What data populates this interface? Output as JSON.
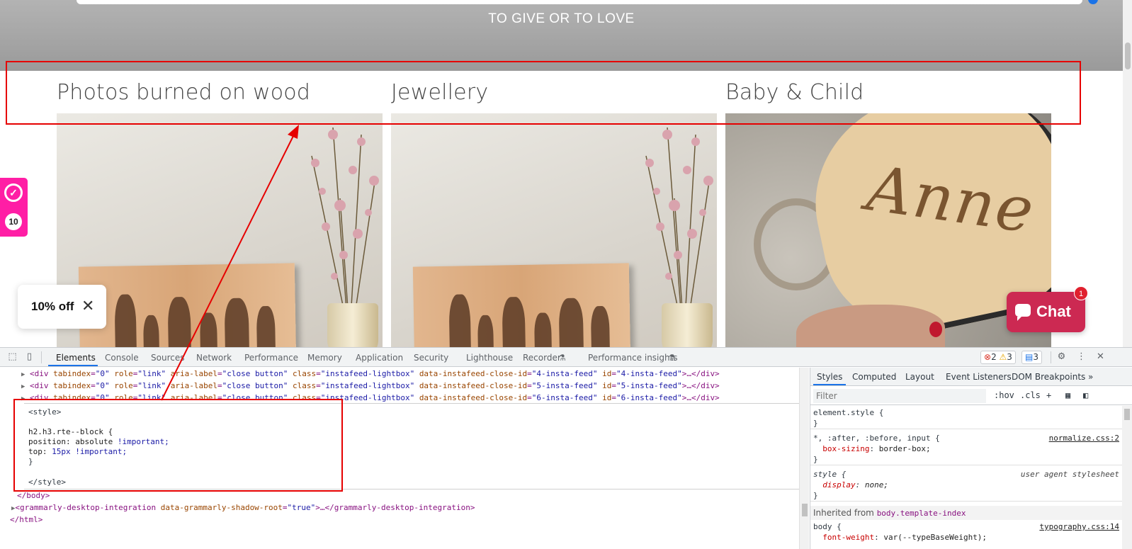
{
  "site": {
    "hero_title": "TO GIVE OR TO LOVE",
    "columns": [
      {
        "title": "Photos burned on wood",
        "image": "wood-photo-family-with-flowers"
      },
      {
        "title": "Jewellery",
        "image": "wood-photo-family-with-flowers"
      },
      {
        "title": "Baby & Child",
        "image": "wooden-heart-engraved-anne"
      }
    ],
    "heart_engraving": "Anne",
    "rewards": {
      "count": "10",
      "icon": "check-circle-icon"
    },
    "discount": {
      "label": "10% off",
      "close": "✕"
    },
    "chat": {
      "label": "Chat",
      "badge": "1"
    }
  },
  "devtools": {
    "tabs": [
      "Elements",
      "Console",
      "Sources",
      "Network",
      "Performance",
      "Memory",
      "Application",
      "Security",
      "Lighthouse",
      "Recorder",
      "Performance insights"
    ],
    "active_tab": "Elements",
    "status": {
      "errors": "2",
      "warnings": "3",
      "messages": "3"
    },
    "dom_lines": [
      {
        "tag": "div",
        "attrs": [
          [
            "tabindex",
            "0"
          ],
          [
            "role",
            "link"
          ],
          [
            "aria-label",
            "close button"
          ],
          [
            "class",
            "instafeed-lightbox"
          ],
          [
            "data-instafeed-close-id",
            "4-insta-feed"
          ],
          [
            "id",
            "4-insta-feed"
          ]
        ],
        "tail": ">…</div>"
      },
      {
        "tag": "div",
        "attrs": [
          [
            "tabindex",
            "0"
          ],
          [
            "role",
            "link"
          ],
          [
            "aria-label",
            "close button"
          ],
          [
            "class",
            "instafeed-lightbox"
          ],
          [
            "data-instafeed-close-id",
            "5-insta-feed"
          ],
          [
            "id",
            "5-insta-feed"
          ]
        ],
        "tail": ">…</div>"
      },
      {
        "tag": "div",
        "attrs": [
          [
            "tabindex",
            "0"
          ],
          [
            "role",
            "link"
          ],
          [
            "aria-label",
            "close button"
          ],
          [
            "class",
            "instafeed-lightbox"
          ],
          [
            "data-instafeed-close-id",
            "6-insta-feed"
          ],
          [
            "id",
            "6-insta-feed"
          ]
        ],
        "tail": ">…</div>"
      }
    ],
    "style_block": {
      "open": "<style>",
      "selector": "h2.h3.rte--block {",
      "decl1_prop": "position:",
      "decl1_val": "absolute",
      "decl1_imp": "!important;",
      "decl2_prop": "top:",
      "decl2_val": "15px",
      "decl2_imp": "!important;",
      "close_brace": "}",
      "close": "</style>"
    },
    "body_close": "</body>",
    "grammarly_line": {
      "tag": "grammarly-desktop-integration",
      "attr": "data-grammarly-shadow-root",
      "val": "true",
      "tail": ">…</grammarly-desktop-integration>"
    },
    "html_close": "</html>",
    "styles_pane": {
      "tabs": [
        "Styles",
        "Computed",
        "Layout",
        "Event Listeners",
        "DOM Breakpoints",
        "»"
      ],
      "filter_placeholder": "Filter",
      "filter_buttons": [
        ":hov",
        ".cls",
        "+"
      ],
      "rules": [
        {
          "selector": "element.style {",
          "source": "",
          "decls": [],
          "close": "}"
        },
        {
          "selector": "*, :after, :before, input {",
          "source": "normalize.css:2",
          "decls": [
            [
              "box-sizing",
              "border-box;"
            ]
          ],
          "close": "}"
        },
        {
          "selector": "style {",
          "source": "user agent stylesheet",
          "decls": [
            [
              "display",
              "none;"
            ]
          ],
          "close": "}"
        }
      ],
      "inherited_label": "Inherited from",
      "inherited_ref": "body.template-index",
      "body_rule": {
        "selector": "body {",
        "source": "typography.css:14",
        "decl_prop": "font-weight",
        "decl_val": "var(--typeBaseWeight);"
      }
    }
  }
}
